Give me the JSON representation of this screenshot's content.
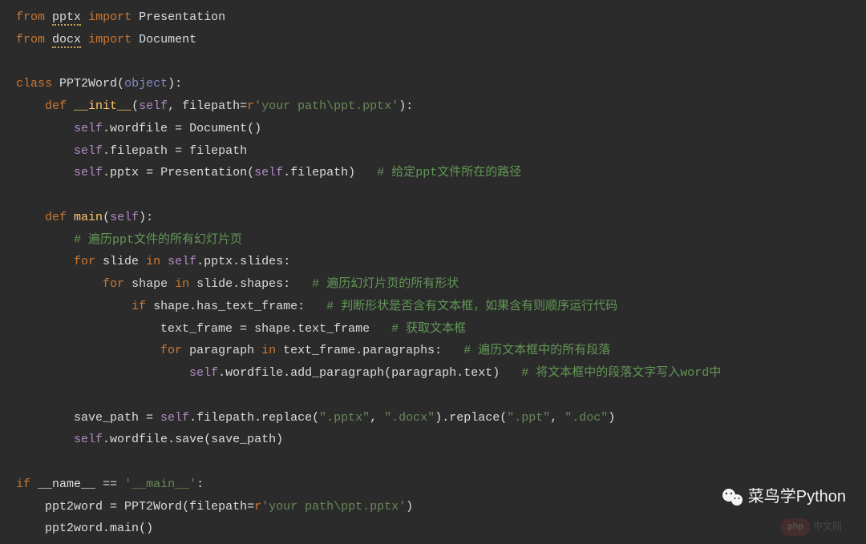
{
  "code": {
    "l1_from": "from",
    "l1_mod": "pptx",
    "l1_import": "import",
    "l1_name": "Presentation",
    "l2_from": "from",
    "l2_mod": "docx",
    "l2_import": "import",
    "l2_name": "Document",
    "l4_class": "class",
    "l4_name": "PPT2Word",
    "l4_obj": "object",
    "l5_def": "def",
    "l5_fn": "__init__",
    "l5_self": "self",
    "l5_param": "filepath",
    "l5_r": "r",
    "l5_str": "'your path\\ppt.pptx'",
    "l6_self": "self",
    "l6_attr": "wordfile",
    "l6_doc": "Document",
    "l7_self": "self",
    "l7_attr": "filepath",
    "l7_val": "filepath",
    "l8_self": "self",
    "l8_attr": "pptx",
    "l8_pres": "Presentation",
    "l8_self2": "self",
    "l8_fp": "filepath",
    "l8_comment": "# 给定ppt文件所在的路径",
    "l10_def": "def",
    "l10_fn": "main",
    "l10_self": "self",
    "l11_comment": "# 遍历ppt文件的所有幻灯片页",
    "l12_for": "for",
    "l12_var": "slide",
    "l12_in": "in",
    "l12_self": "self",
    "l12_pptx": "pptx",
    "l12_slides": "slides",
    "l13_for": "for",
    "l13_var": "shape",
    "l13_in": "in",
    "l13_slide": "slide",
    "l13_shapes": "shapes",
    "l13_comment": "# 遍历幻灯片页的所有形状",
    "l14_if": "if",
    "l14_shape": "shape",
    "l14_htf": "has_text_frame",
    "l14_comment": "# 判断形状是否含有文本框，如果含有则顺序运行代码",
    "l15_tf": "text_frame",
    "l15_shape": "shape",
    "l15_tf2": "text_frame",
    "l15_comment": "# 获取文本框",
    "l16_for": "for",
    "l16_var": "paragraph",
    "l16_in": "in",
    "l16_tf": "text_frame",
    "l16_para": "paragraphs",
    "l16_comment": "# 遍历文本框中的所有段落",
    "l17_self": "self",
    "l17_wf": "wordfile",
    "l17_ap": "add_paragraph",
    "l17_para": "paragraph",
    "l17_text": "text",
    "l17_comment": "# 将文本框中的段落文字写入word中",
    "l19_sp": "save_path",
    "l19_self": "self",
    "l19_fp": "filepath",
    "l19_rep": "replace",
    "l19_s1": "\".pptx\"",
    "l19_s2": "\".docx\"",
    "l19_rep2": "replace",
    "l19_s3": "\".ppt\"",
    "l19_s4": "\".doc\"",
    "l20_self": "self",
    "l20_wf": "wordfile",
    "l20_save": "save",
    "l20_sp": "save_path",
    "l22_if": "if",
    "l22_name": "__name__",
    "l22_eq": "==",
    "l22_main": "'__main__'",
    "l23_var": "ppt2word",
    "l23_cls": "PPT2Word",
    "l23_fp": "filepath",
    "l23_r": "r",
    "l23_str": "'your path\\ppt.pptx'",
    "l24_var": "ppt2word",
    "l24_main": "main"
  },
  "watermark": {
    "text": "菜鸟学Python",
    "php": "php",
    "cn": "中文网"
  }
}
